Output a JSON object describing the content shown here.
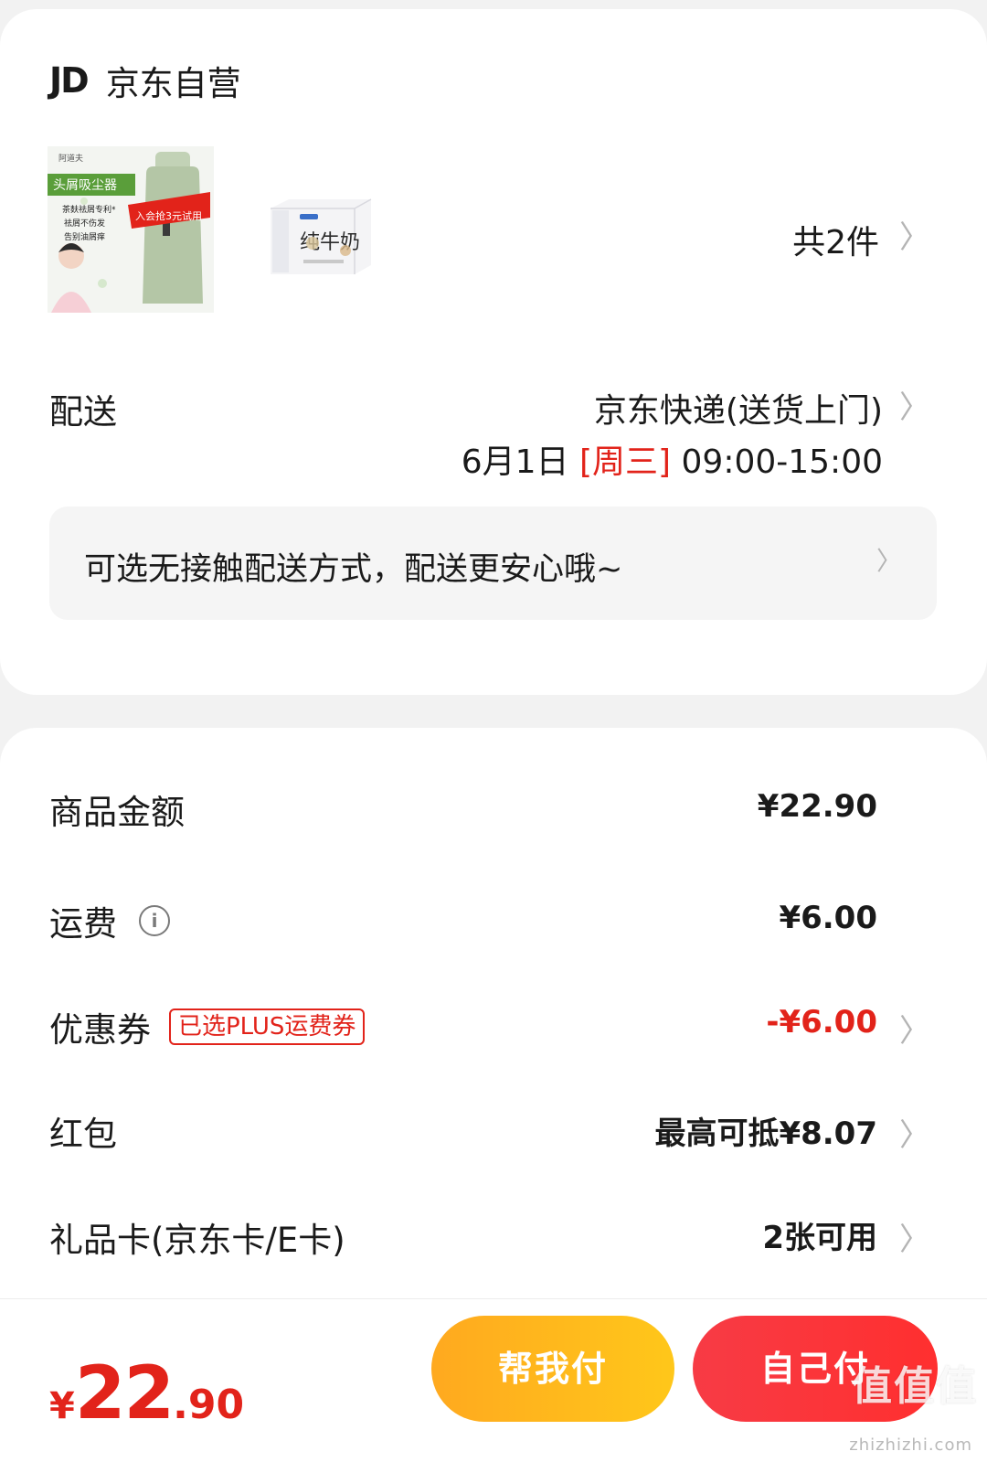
{
  "store": {
    "logo_text": "JD",
    "name": "京东自营"
  },
  "products": {
    "item1": {
      "brand": "阿道夫",
      "tag": "头屑吸尘器",
      "promo": "入会抢3元试用",
      "line1": "茶麸祛屑专利*",
      "line2": "祛屑不伤发",
      "line3": "告别油屑痒"
    },
    "item2": {
      "title": "纯牛奶"
    },
    "count_label": "共2件"
  },
  "delivery": {
    "label": "配送",
    "method": "京东快递(送货上门)",
    "date": "6月1日",
    "weekday": "[周三]",
    "time": "09:00-15:00",
    "contactless": "可选无接触配送方式，配送更安心哦~"
  },
  "price_rows": {
    "goods": {
      "label": "商品金额",
      "value": "¥22.90"
    },
    "shipping": {
      "label": "运费",
      "value": "¥6.00"
    },
    "coupon": {
      "label": "优惠券",
      "badge": "已选PLUS运费券",
      "value": "-¥6.00"
    },
    "redpacket": {
      "label": "红包",
      "value": "最高可抵¥8.07"
    },
    "giftcard": {
      "label": "礼品卡(京东卡/E卡)",
      "value": "2张可用"
    }
  },
  "bottom": {
    "total_yen": "¥",
    "total_int": "22",
    "total_dec": ".90",
    "help_pay": "帮我付",
    "self_pay": "自己付"
  },
  "watermark": {
    "text": "值值值",
    "url": "zhizhizhi.com"
  },
  "colors": {
    "accent_red": "#e2231a",
    "help_btn": "#ffb51d",
    "self_btn": "#f93640"
  }
}
